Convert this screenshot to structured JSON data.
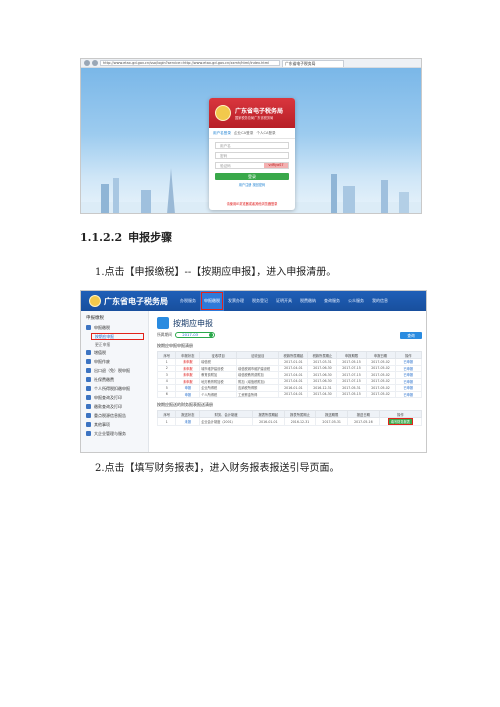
{
  "browser": {
    "url": "http://www.etax-gd.gov.cn/sso/login?service=http://www.etax-gd.gov.cn/xxmh/html/index.html",
    "tab_title": "广东省电子税务局"
  },
  "login": {
    "title": "广东省电子税务局",
    "subtitle": "国家税务总局广东省税务局",
    "tabs": [
      "用户名登录",
      "企业CA登录",
      "个人CA登录"
    ],
    "username_placeholder": "用户名",
    "password_placeholder": "密码",
    "captcha_placeholder": "验证码",
    "captcha_image": "vdRyaS7",
    "login_button": "登录",
    "links": "用户注册  找回密码",
    "footer": "请使用IE浏览器或者其他浏览器登录"
  },
  "doc": {
    "heading_number": "1.1.2.2",
    "heading_text": "申报步骤",
    "step1": "1.点击【申报缴税】--【按期应申报】，进入申报清册。",
    "step2": "2.点击【填写财务报表】，进入财务报表报送引导页面。"
  },
  "site": {
    "name": "广东省电子税务局",
    "nav": [
      "办税服务",
      "申报缴税",
      "发票办理",
      "税务登记",
      "证明开具",
      "税费缴纳",
      "查询服务",
      "公众服务",
      "我的信息"
    ],
    "active_nav_index": 1,
    "left_menu_title": "申报缴税",
    "left_menu": {
      "top": "申报缴税",
      "sub_selected": "按期应申报",
      "sub_other": "更正申报",
      "items": [
        "增值税",
        "申报作废",
        "出口退（免）税申报",
        "社保费缴费",
        "个人所得税扣缴申报",
        "申报查询及打印",
        "缴款查询及打印",
        "重点税源信息报告",
        "其他事项",
        "大企业管理与服务"
      ]
    },
    "page_title": "按期应申报",
    "period_label": "所属期间",
    "period_value": "2017-03",
    "query_button": "查询",
    "section1": "按期应申报申报清册",
    "table1": {
      "headers": [
        "序号",
        "申报状态",
        "征收项目",
        "征收品目",
        "税款所属期起",
        "税款所属期止",
        "申报期限",
        "申报日期",
        "操作"
      ],
      "rows": [
        [
          "1",
          "未申报",
          "增值税",
          "",
          "2017-01-01",
          "2017-03-31",
          "2017-05-15",
          "2017-05-02",
          "已申报"
        ],
        [
          "2",
          "未申报",
          "城市维护建设税",
          "增值税城市维护建设税",
          "2017-04-01",
          "2017-06-30",
          "2017-07-15",
          "2017-05-02",
          "已申报"
        ],
        [
          "3",
          "未申报",
          "教育费附加",
          "增值税教育费附加",
          "2017-04-01",
          "2017-06-30",
          "2017-07-15",
          "2017-05-02",
          "已申报"
        ],
        [
          "4",
          "未申报",
          "地方教育附加税",
          "附加（增值税附加）",
          "2017-04-01",
          "2017-06-30",
          "2017-07-15",
          "2017-05-02",
          "已申报"
        ],
        [
          "5",
          "申报",
          "企业所得税",
          "应纳税所得额",
          "2016-01-01",
          "2016-12-31",
          "2017-05-31",
          "2017-05-02",
          "已申报"
        ],
        [
          "6",
          "申报",
          "个人所得税",
          "工资薪金所得",
          "2017-04-01",
          "2017-04-30",
          "2017-05-15",
          "2017-05-02",
          "已申报"
        ]
      ]
    },
    "section2": "按期应报送的财务报表报送清册",
    "table2": {
      "headers": [
        "序号",
        "报送状态",
        "财务、会计制度",
        "报表所属期起",
        "报表所属期止",
        "报送期限",
        "报送日期",
        "操作"
      ],
      "rows": [
        [
          "1",
          "未报",
          "企业会计制度（2001）",
          "2016-01-01",
          "2016-12-31",
          "2017-05-31",
          "2017-05-16",
          "填写财务报表"
        ]
      ]
    }
  }
}
